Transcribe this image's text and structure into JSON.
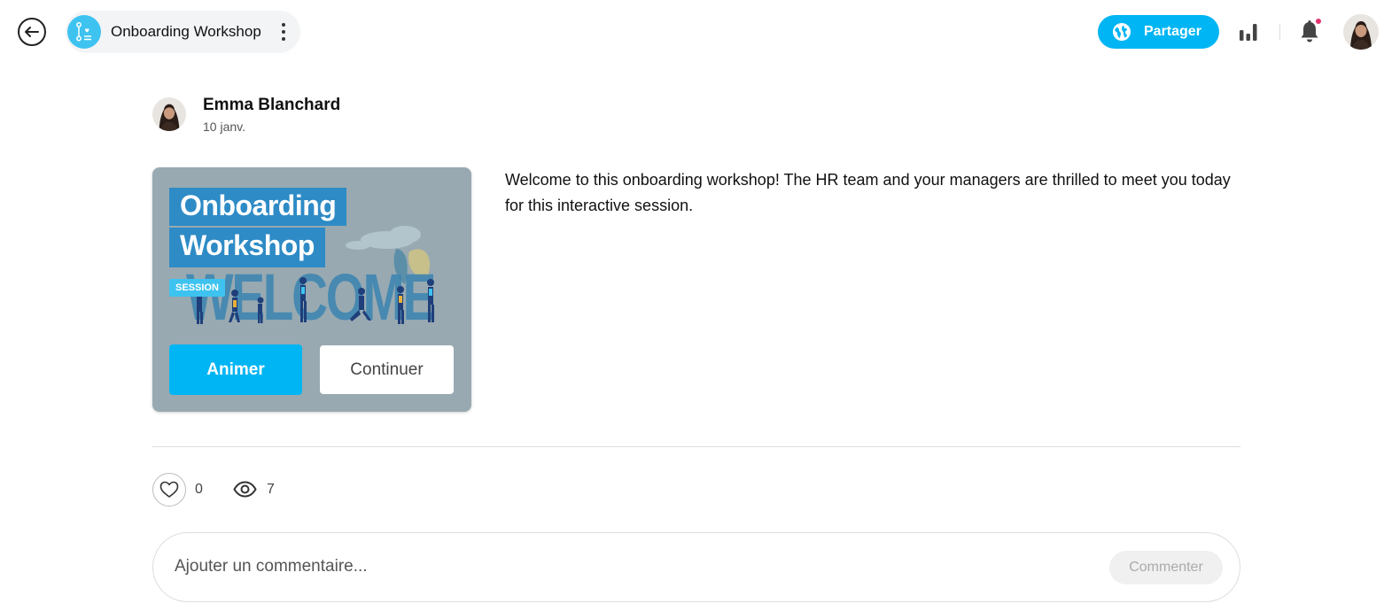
{
  "header": {
    "title": "Onboarding Workshop",
    "share_label": "Partager"
  },
  "post": {
    "author": "Emma Blanchard",
    "date": "10 janv.",
    "description": "Welcome to this onboarding workshop! The HR team and your managers are thrilled to meet you today for this interactive session."
  },
  "card": {
    "title_line1": "Onboarding",
    "title_line2": "Workshop",
    "badge": "SESSION",
    "art_word": "WELCOME",
    "primary_button": "Animer",
    "secondary_button": "Continuer"
  },
  "stats": {
    "likes": "0",
    "views": "7"
  },
  "comment": {
    "placeholder": "Ajouter un commentaire...",
    "submit_label": "Commenter"
  },
  "colors": {
    "accent": "#00b5f3",
    "card_bg": "#98a9b1",
    "title_bg": "#2e8bc6",
    "notification_dot": "#e6336f"
  },
  "icons": [
    "back-arrow-icon",
    "workshop-icon",
    "more-vertical-icon",
    "globe-icon",
    "bar-chart-icon",
    "bell-icon",
    "heart-icon",
    "eye-icon"
  ]
}
